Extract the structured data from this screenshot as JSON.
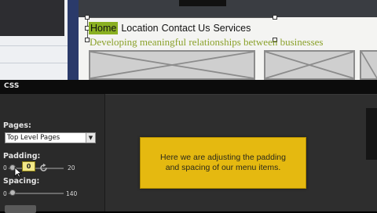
{
  "preview": {
    "nav_items": [
      "Home",
      "Location",
      "Contact Us",
      "Services"
    ],
    "active_item": "Home",
    "tagline": "Developing meaningful relationships between businesses"
  },
  "css_panel": {
    "title": "CSS",
    "pages_label": "Pages:",
    "pages_selected": "Top Level Pages",
    "padding_label": "Padding:",
    "padding_min": "0",
    "padding_value": "0",
    "padding_max": "20",
    "spacing_label": "Spacing:",
    "spacing_min": "0",
    "spacing_max": "140",
    "tooltip": "Here we are adjusting the padding and spacing of our menu items."
  },
  "colors": {
    "active_nav": "#8ab021",
    "tagline": "#8aa12a",
    "tooltip_bg": "#e5b910",
    "panel_bg": "#2e2e2e"
  },
  "icons": [
    "chevron-down-icon",
    "rotate-icon",
    "cursor-icon"
  ]
}
